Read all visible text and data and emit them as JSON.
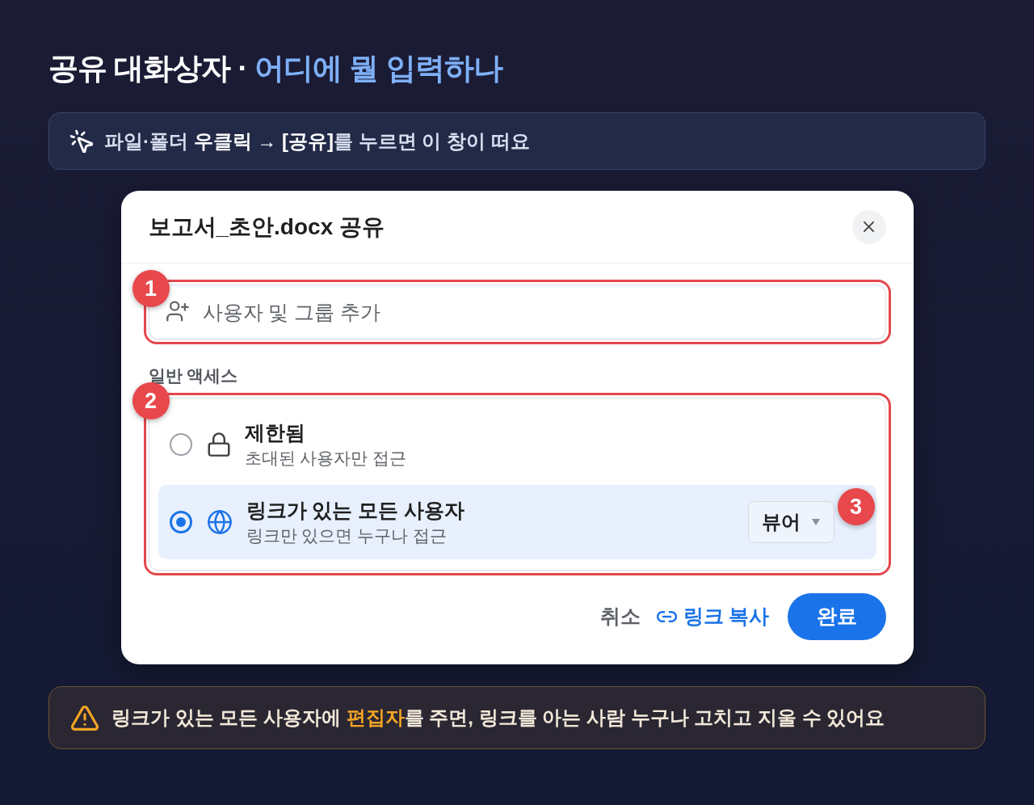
{
  "title": {
    "text": "공유 대화상자 ·",
    "accent": "어디에 뭘 입력하나"
  },
  "tip": {
    "text": "파일·폴더 **우클릭 → [공유]**를 누르면 이 창이 떠요"
  },
  "dialog": {
    "title": "보고서_초안.docx 공유",
    "add_field": {
      "placeholder": "사용자 및 그룹 추가",
      "callout": "1"
    },
    "access": {
      "label": "일반 액세스",
      "callout": "2",
      "options": [
        {
          "kind": "restricted",
          "title": "제한됨",
          "description": "초대된 사용자만 접근",
          "selected": false
        },
        {
          "kind": "link",
          "title": "링크가 있는 모든 사용자",
          "description": "링크만 있으면 누구나 접근",
          "selected": true,
          "role": {
            "value": "뷰어",
            "callout": "3"
          }
        }
      ]
    },
    "buttons": [
      {
        "kind": "text",
        "label": "취소"
      },
      {
        "kind": "link",
        "label": "링크 복사"
      },
      {
        "kind": "primary",
        "label": "완료"
      }
    ]
  },
  "warning": {
    "text": "링크가 있는 모든 사용자에 **편집자**를 주면, 링크를 아는 사람 누구나 고치고 지울 수 있어요"
  }
}
